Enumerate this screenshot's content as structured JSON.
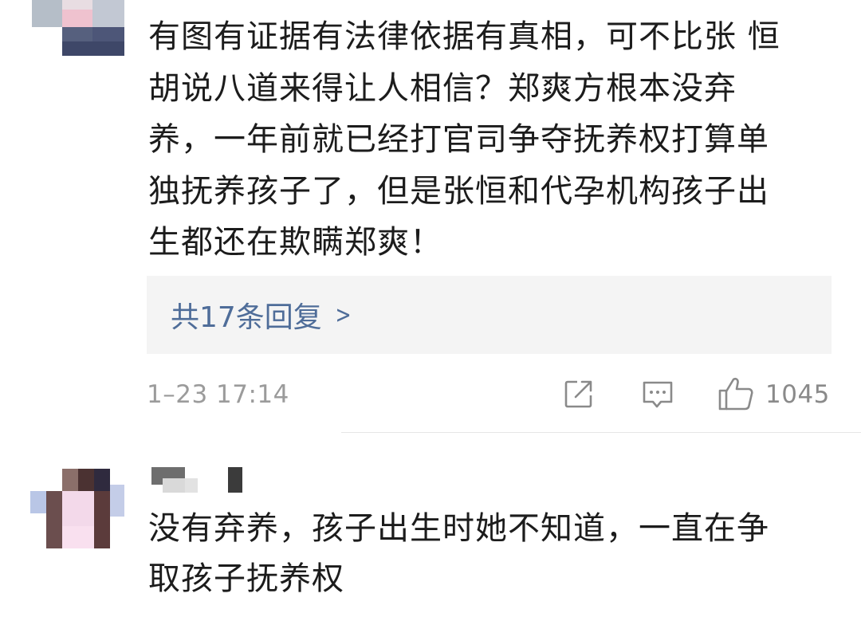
{
  "comments": [
    {
      "avatar": "pixelated-avatar",
      "lines": [
        "有图有证据有法律依据有真相，可不比张 恒",
        "胡说八道来得让人相信？郑爽方根本没弃",
        "养，一年前就已经打官司争夺抚养权打算单",
        "独抚养孩子了，但是张恒和代孕机构孩子出",
        "生都还在欺瞒郑爽！"
      ],
      "replies_label": "共17条回复",
      "replies_chevron": ">",
      "timestamp": "1–23 17:14",
      "actions": {
        "share_icon": "share-icon",
        "comment_icon": "comment-icon",
        "like_icon": "thumbs-up-icon",
        "like_count": "1045"
      }
    },
    {
      "avatar": "pixelated-avatar",
      "username": "",
      "lines": [
        "没有弃养，孩子出生时她不知道，一直在争",
        "取孩子抚养权"
      ]
    }
  ],
  "colors": {
    "link": "#4f6d99",
    "meta": "#9b9b9b",
    "reply_bg": "#f4f4f4",
    "text": "#1c1c1c"
  }
}
